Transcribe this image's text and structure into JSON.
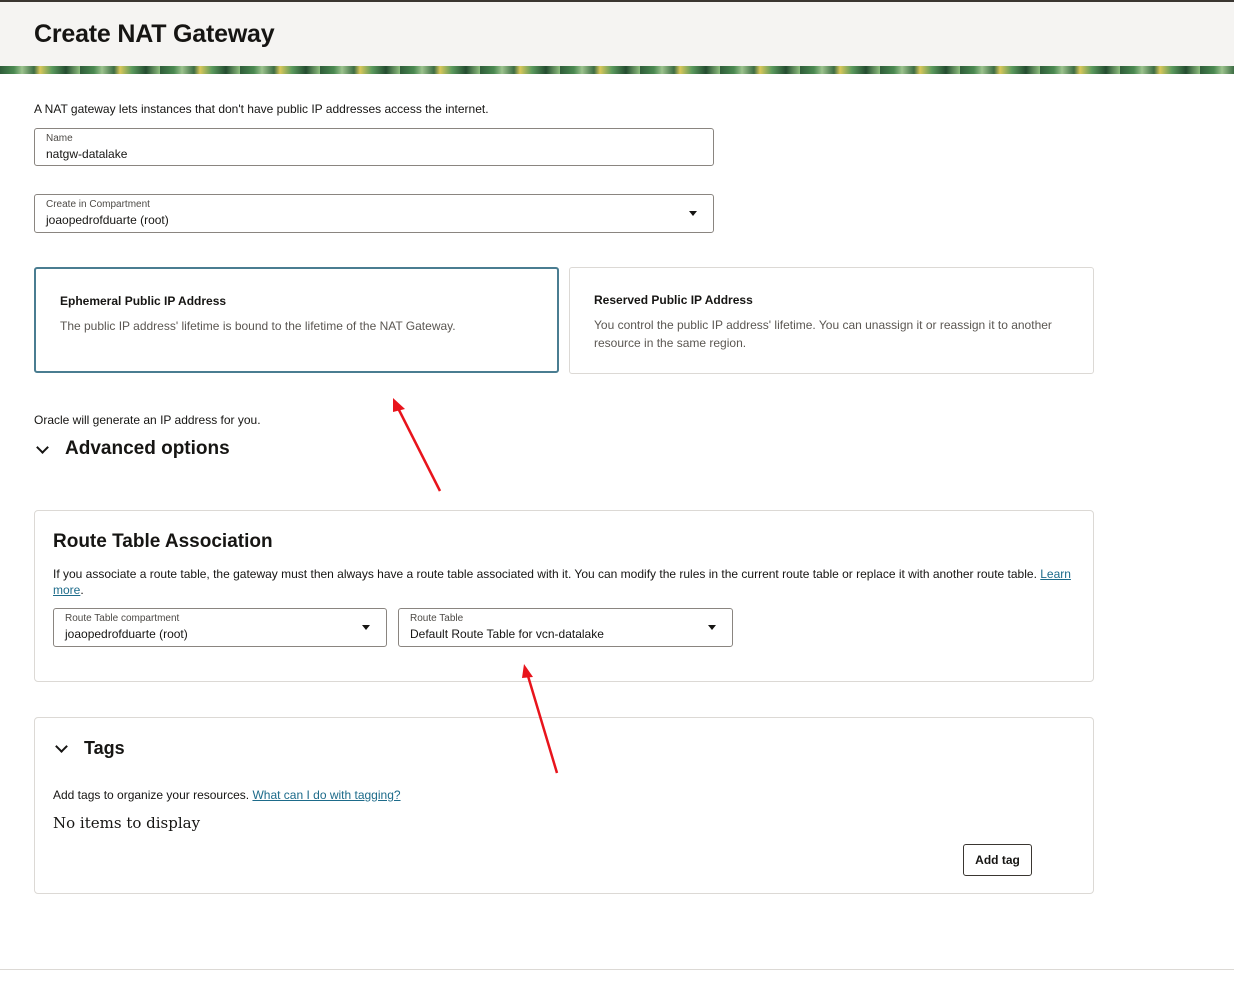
{
  "header": {
    "title": "Create NAT Gateway"
  },
  "intro": "A NAT gateway lets instances that don't have public IP addresses access the internet.",
  "name_field": {
    "label": "Name",
    "value": "natgw-datalake"
  },
  "compartment_field": {
    "label": "Create in Compartment",
    "value": "joaopedrofduarte (root)"
  },
  "ip_options": [
    {
      "title": "Ephemeral Public IP Address",
      "description": "The public IP address' lifetime is bound to the lifetime of the NAT Gateway.",
      "selected": true
    },
    {
      "title": "Reserved Public IP Address",
      "description": "You control the public IP address' lifetime. You can unassign it or reassign it to another resource in the same region.",
      "selected": false
    }
  ],
  "ip_note": "Oracle will generate an IP address for you.",
  "advanced": {
    "title": "Advanced options",
    "expanded": true
  },
  "route_table_section": {
    "title": "Route Table Association",
    "description": "If you associate a route table, the gateway must then always have a route table associated with it. You can modify the rules in the current route table or replace it with another route table.",
    "learn_more": "Learn more",
    "compartment": {
      "label": "Route Table compartment",
      "value": "joaopedrofduarte (root)"
    },
    "route_table": {
      "label": "Route Table",
      "value": "Default Route Table for vcn-datalake"
    }
  },
  "tags_section": {
    "title": "Tags",
    "expanded": true,
    "description": "Add tags to organize your resources.",
    "help_link": "What can I do with tagging?",
    "empty_text": "No items to display",
    "add_button": "Add tag"
  },
  "colors": {
    "selected_border": "#4a7d91",
    "link": "#1d6b8a",
    "annotation_arrow": "#e8141c"
  }
}
